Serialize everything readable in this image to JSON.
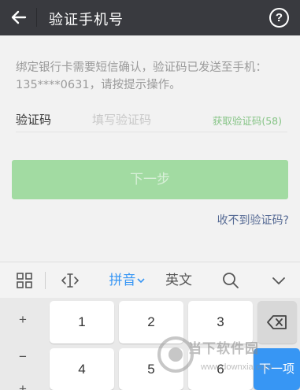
{
  "header": {
    "title": "验证手机号",
    "help_glyph": "?"
  },
  "main": {
    "description": "绑定银行卡需要短信确认，验证码已发送至手机：135****0631，请按提示操作。",
    "code_label": "验证码",
    "code_placeholder": "填写验证码",
    "code_value": "",
    "get_code_label": "获取验证码(58)",
    "next_button_label": "下一步",
    "no_code_link": "收不到验证码?"
  },
  "keyboard_toolbar": {
    "grid_icon": "grid-icon",
    "cursor_icon": "text-cursor-icon",
    "pinyin_label": "拼音",
    "english_label": "英文",
    "search_icon": "search-icon",
    "collapse_icon": "chevron-down-icon"
  },
  "keyboard": {
    "side_symbols": [
      "+",
      "−",
      "+"
    ],
    "row1": [
      "1",
      "2",
      "3"
    ],
    "row2": [
      "4",
      "5",
      "6"
    ],
    "next_label": "下一项"
  },
  "watermark": {
    "cn": "当下软件园",
    "en": "www.downxia.com"
  },
  "colors": {
    "title_bar": "#393a3f",
    "next_button_disabled": "#a2dba2",
    "get_code_green": "#86c486",
    "link_blue": "#576b95",
    "keyboard_accent": "#3796f4"
  }
}
